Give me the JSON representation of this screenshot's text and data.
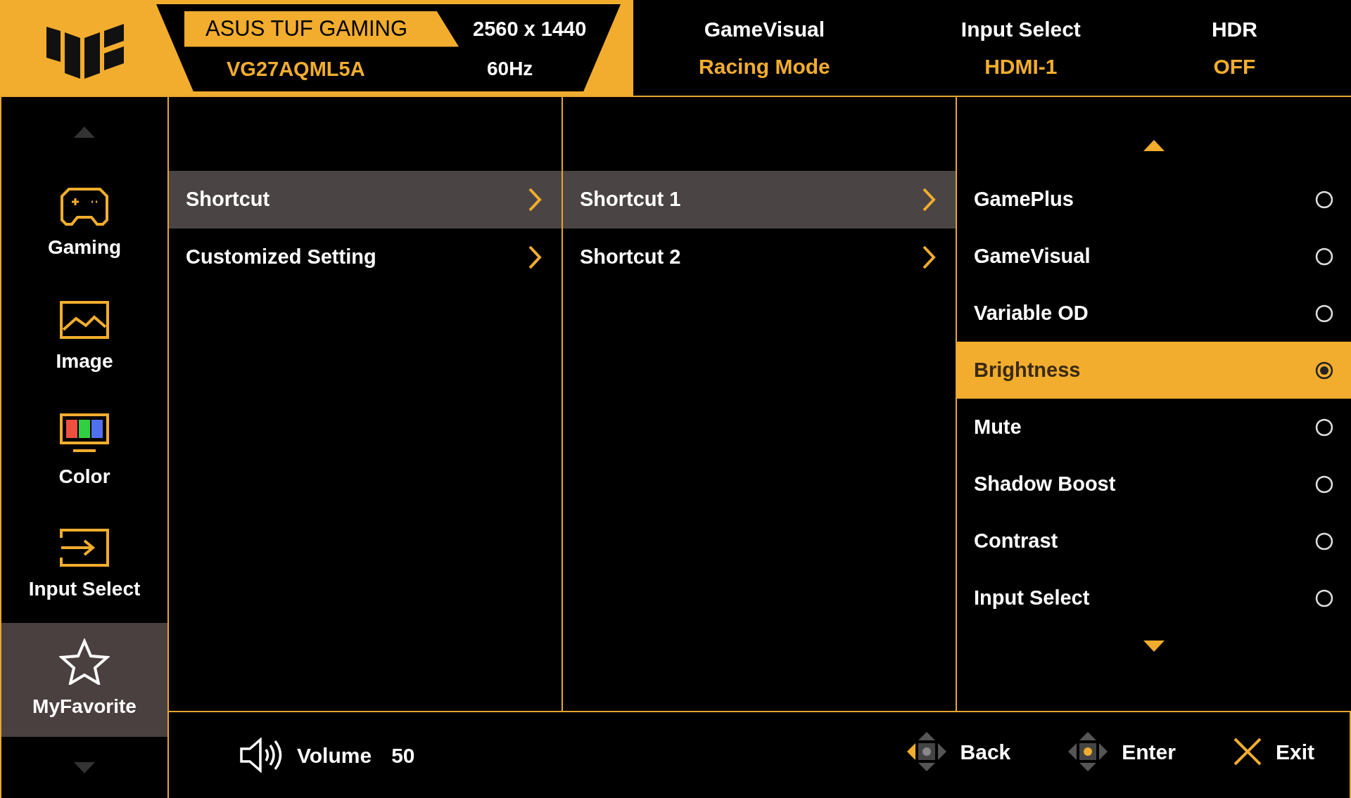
{
  "header": {
    "brand": "ASUS TUF GAMING",
    "model": "VG27AQML5A",
    "resolution": "2560 x 1440",
    "refresh": "60Hz",
    "info": [
      {
        "label": "GameVisual",
        "value": "Racing Mode"
      },
      {
        "label": "Input Select",
        "value": "HDMI-1"
      },
      {
        "label": "HDR",
        "value": "OFF"
      }
    ]
  },
  "sidebar": {
    "items": [
      {
        "kind": "gaming",
        "label": "Gaming",
        "selected": false
      },
      {
        "kind": "image",
        "label": "Image",
        "selected": false
      },
      {
        "kind": "color",
        "label": "Color",
        "selected": false
      },
      {
        "kind": "input",
        "label": "Input Select",
        "selected": false
      },
      {
        "kind": "favorite",
        "label": "MyFavorite",
        "selected": true
      }
    ]
  },
  "menu": {
    "column_1": [
      {
        "label": "Shortcut",
        "selected": true
      },
      {
        "label": "Customized Setting",
        "selected": false
      }
    ],
    "column_2": [
      {
        "label": "Shortcut 1",
        "selected": true
      },
      {
        "label": "Shortcut 2",
        "selected": false
      }
    ],
    "options": [
      {
        "label": "GamePlus",
        "selected": false
      },
      {
        "label": "GameVisual",
        "selected": false
      },
      {
        "label": "Variable OD",
        "selected": false
      },
      {
        "label": "Brightness",
        "selected": true
      },
      {
        "label": "Mute",
        "selected": false
      },
      {
        "label": "Shadow Boost",
        "selected": false
      },
      {
        "label": "Contrast",
        "selected": false
      },
      {
        "label": "Input Select",
        "selected": false
      }
    ]
  },
  "footer": {
    "volume_label": "Volume",
    "volume_value": "50",
    "keys": [
      {
        "kind": "back",
        "label": "Back"
      },
      {
        "kind": "enter",
        "label": "Enter"
      },
      {
        "kind": "exit",
        "label": "Exit"
      }
    ]
  }
}
